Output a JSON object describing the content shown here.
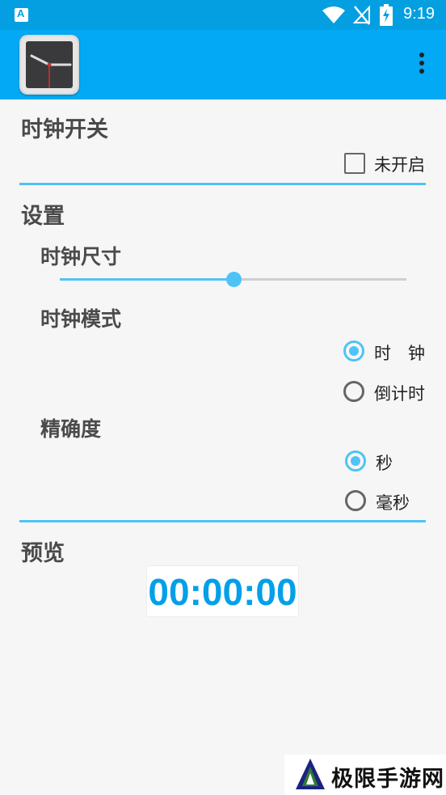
{
  "status_bar": {
    "time": "9:19",
    "icons": [
      "app-notification-icon",
      "wifi-icon",
      "no-signal-icon",
      "battery-charging-icon"
    ]
  },
  "app_bar": {
    "logo_icon": "analog-clock-icon",
    "menu_icon": "overflow-menu-icon"
  },
  "clock_switch": {
    "title": "时钟开关",
    "checkbox_label": "未开启",
    "checked": false
  },
  "settings": {
    "title": "设置",
    "size": {
      "label": "时钟尺寸",
      "value_fraction": 0.5
    },
    "mode": {
      "label": "时钟模式",
      "options": [
        {
          "label": "时　钟",
          "checked": true
        },
        {
          "label": "倒计时",
          "checked": false
        }
      ]
    },
    "precision": {
      "label": "精确度",
      "options": [
        {
          "label": "秒",
          "checked": true
        },
        {
          "label": "毫秒",
          "checked": false
        }
      ]
    }
  },
  "preview": {
    "title": "预览",
    "time": "00:00:00"
  },
  "watermark": {
    "text": "极限手游网"
  },
  "colors": {
    "primary": "#03a9f4",
    "primary_dark": "#039fe0",
    "accent": "#4fc3f7",
    "preview_text": "#03a0e8"
  }
}
